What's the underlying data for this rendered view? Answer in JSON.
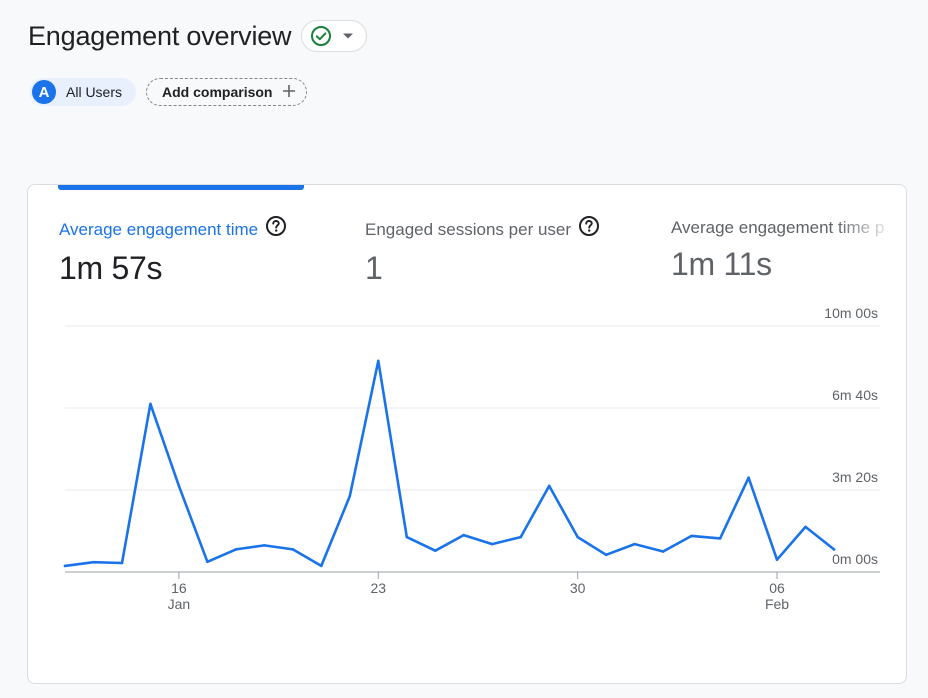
{
  "header": {
    "title": "Engagement overview",
    "status_icon": "check-circle-icon",
    "dropdown_icon": "caret-down-icon"
  },
  "segments": {
    "primary": {
      "avatar_letter": "A",
      "label": "All Users"
    },
    "add_comparison": {
      "label": "Add comparison",
      "icon": "plus-icon"
    }
  },
  "metrics": [
    {
      "label": "Average engagement time",
      "value": "1m 57s",
      "help_icon": "help-circle-icon",
      "active": true
    },
    {
      "label": "Engaged sessions per user",
      "value": "1",
      "help_icon": "help-circle-icon",
      "active": false
    },
    {
      "label": "Average engagement time p",
      "value": "1m 11s",
      "active": false
    }
  ],
  "colors": {
    "accent": "#1a73e8",
    "line": "#1a73e8",
    "grid": "#e8eaed",
    "status_green": "#188038"
  },
  "chart_data": {
    "type": "line",
    "xlabel": "",
    "ylabel": "",
    "grid": true,
    "y_unit": "seconds",
    "ylim": [
      0,
      600
    ],
    "y_ticks": [
      {
        "value": 0,
        "label": "0m 00s"
      },
      {
        "value": 200,
        "label": "3m 20s"
      },
      {
        "value": 400,
        "label": "6m 40s"
      },
      {
        "value": 600,
        "label": "10m 00s"
      }
    ],
    "x_ticks": [
      {
        "index": 4,
        "label": "16",
        "sublabel": "Jan"
      },
      {
        "index": 11,
        "label": "23",
        "sublabel": ""
      },
      {
        "index": 18,
        "label": "30",
        "sublabel": ""
      },
      {
        "index": 25,
        "label": "06",
        "sublabel": "Feb"
      }
    ],
    "series": [
      {
        "values": [
          15,
          24,
          22,
          410,
          210,
          25,
          55,
          65,
          55,
          15,
          185,
          515,
          85,
          52,
          90,
          68,
          85,
          210,
          85,
          42,
          68,
          50,
          88,
          82,
          230,
          30,
          110,
          55
        ]
      }
    ]
  }
}
